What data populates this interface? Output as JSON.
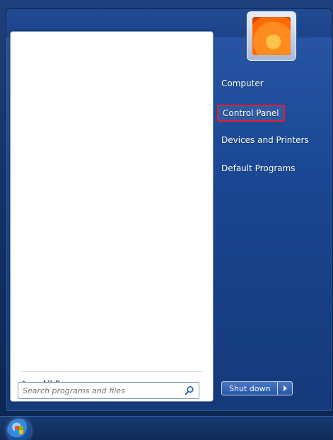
{
  "start_menu": {
    "right_items": [
      {
        "label": "Computer"
      },
      {
        "label": "Control Panel",
        "selected": true
      },
      {
        "label": "Devices and Printers"
      },
      {
        "label": "Default Programs"
      }
    ],
    "all_programs_label": "All Programs",
    "search_placeholder": "Search programs and files",
    "shutdown_label": "Shut down"
  },
  "colors": {
    "highlight_border": "#e21f2c",
    "menu_blue": "#1c4a97"
  },
  "icons": {
    "avatar": "user-avatar-flower",
    "search": "search-icon",
    "start": "start-orb-icon"
  }
}
